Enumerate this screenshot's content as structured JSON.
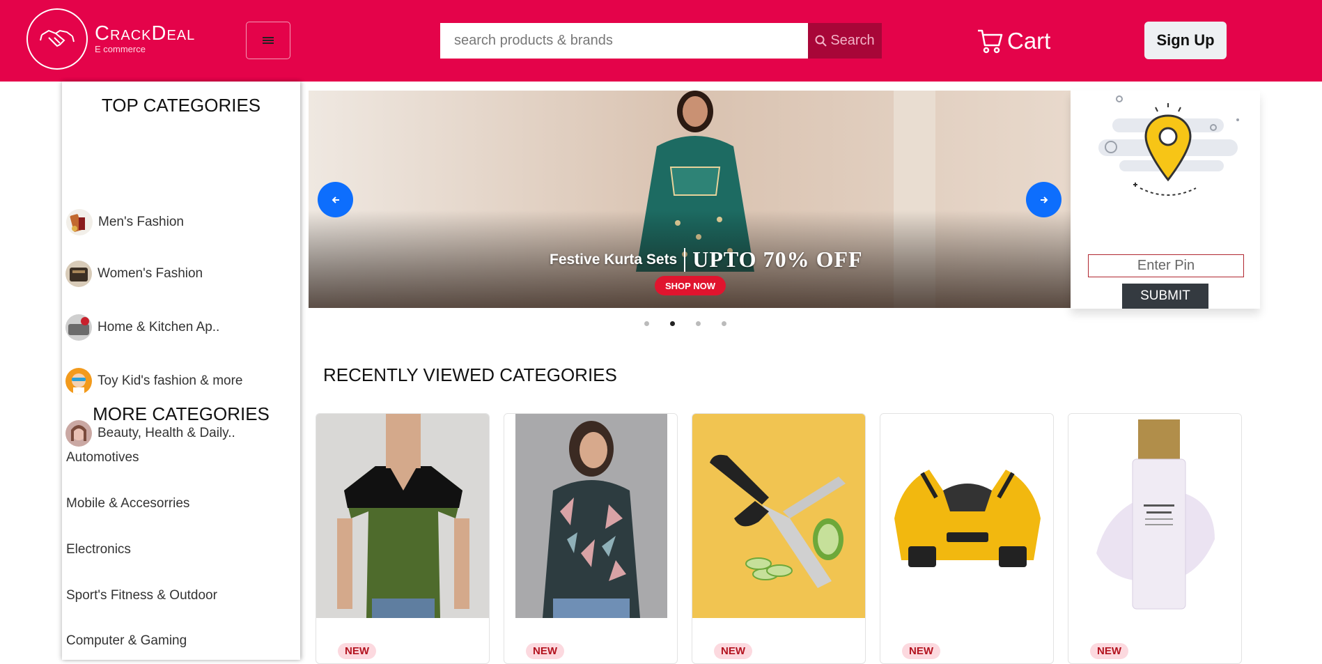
{
  "header": {
    "brand_name": "CrackDeal",
    "brand_tagline": "E commerce",
    "search_placeholder": "search products & brands",
    "search_label": "Search",
    "cart_label": "Cart",
    "signup_label": "Sign Up"
  },
  "sidebar": {
    "top_heading": "TOP CATEGORIES",
    "top_categories": [
      {
        "label": "Men's Fashion",
        "icon": "mens-fashion-avatar"
      },
      {
        "label": "Women's Fashion",
        "icon": "womens-fashion-avatar"
      },
      {
        "label": "Home & Kitchen Ap..",
        "icon": "home-kitchen-avatar"
      },
      {
        "label": "Toy Kid's fashion & more",
        "icon": "toy-kids-avatar"
      },
      {
        "label": "Beauty, Health & Daily..",
        "icon": "beauty-health-avatar"
      }
    ],
    "more_heading": "MORE CATEGORIES",
    "more_categories": [
      {
        "label": "Automotives"
      },
      {
        "label": "Mobile & Accesorries"
      },
      {
        "label": "Electronics"
      },
      {
        "label": "Sport's Fitness & Outdoor"
      },
      {
        "label": "Computer & Gaming"
      }
    ]
  },
  "carousel": {
    "banner_sub": "Festive Kurta Sets",
    "banner_main": "UPTO 70% OFF",
    "shop_now": "SHOP NOW",
    "active_slide": 2,
    "slide_count": 4
  },
  "pincode": {
    "placeholder": "Enter Pin",
    "submit_label": "SUBMIT"
  },
  "recently_viewed": {
    "title": "RECENTLY VIEWED CATEGORIES",
    "cards": [
      {
        "badge": "NEW",
        "image": "green-black-tshirt"
      },
      {
        "badge": "NEW",
        "image": "printed-shirt-woman"
      },
      {
        "badge": "NEW",
        "image": "vegetable-scissors"
      },
      {
        "badge": "NEW",
        "image": "yellow-toy-car"
      },
      {
        "badge": "NEW",
        "image": "makeup-base-bottle"
      }
    ]
  },
  "colors": {
    "brand": "#e4034a",
    "search_button": "#a80638",
    "carousel_button": "#0d6efd",
    "badge_bg": "#fcd9df",
    "badge_text": "#b3131f"
  }
}
